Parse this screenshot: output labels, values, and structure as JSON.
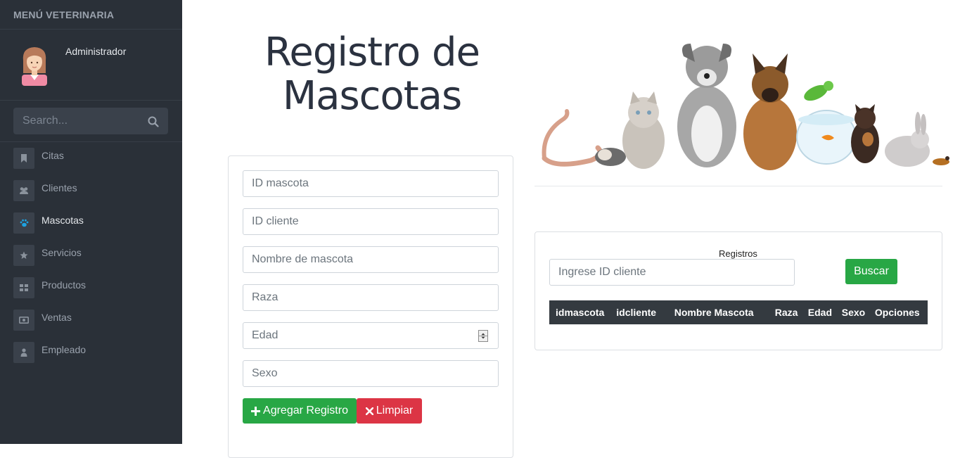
{
  "sidebar": {
    "header": "MENÚ VETERINARIA",
    "user_name": "Administrador",
    "search_placeholder": "Search...",
    "items": [
      {
        "label": "Citas",
        "icon": "bookmark-icon"
      },
      {
        "label": "Clientes",
        "icon": "users-icon"
      },
      {
        "label": "Mascotas",
        "icon": "paw-icon",
        "active": true
      },
      {
        "label": "Servicios",
        "icon": "star-icon"
      },
      {
        "label": "Productos",
        "icon": "grid-icon"
      },
      {
        "label": "Ventas",
        "icon": "money-icon"
      },
      {
        "label": "Empleado",
        "icon": "user-icon"
      }
    ]
  },
  "main": {
    "title_line1": "Registro de",
    "title_line2": "Mascotas",
    "form": {
      "id_mascota_placeholder": "ID mascota",
      "id_cliente_placeholder": "ID cliente",
      "nombre_placeholder": "Nombre de mascota",
      "raza_placeholder": "Raza",
      "edad_placeholder": "Edad",
      "sexo_placeholder": "Sexo",
      "add_label": "Agregar Registro",
      "clear_label": "Limpiar"
    },
    "search": {
      "label": "Registros",
      "placeholder": "Ingrese ID cliente",
      "button": "Buscar"
    },
    "table": {
      "headers": [
        "idmascota",
        "idcliente",
        "Nombre Mascota",
        "Raza",
        "Edad",
        "Sexo",
        "Opciones"
      ]
    }
  },
  "colors": {
    "sidebar_bg": "#2a3038",
    "accent_active_icon": "#1ea2e0",
    "success": "#28a745",
    "danger": "#dc3545",
    "table_header": "#343a40"
  }
}
